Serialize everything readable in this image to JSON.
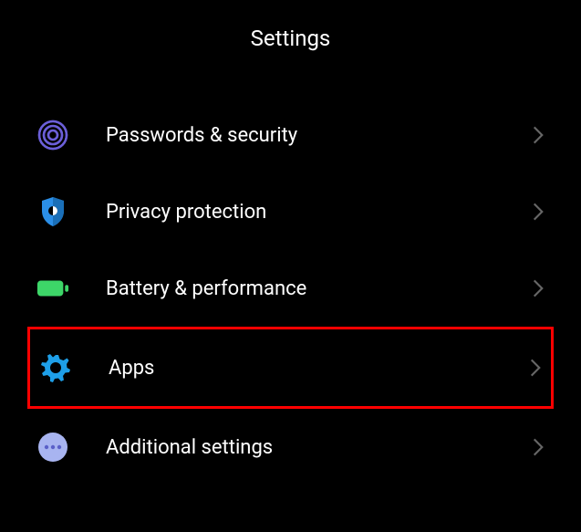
{
  "header": {
    "title": "Settings"
  },
  "items": [
    {
      "label": "Passwords & security",
      "icon": "fingerprint-icon",
      "iconColor": "#6B5FD8",
      "highlighted": false
    },
    {
      "label": "Privacy protection",
      "icon": "shield-icon",
      "iconColor": "#2B8FE8",
      "highlighted": false
    },
    {
      "label": "Battery & performance",
      "icon": "battery-icon",
      "iconColor": "#3DD668",
      "highlighted": false
    },
    {
      "label": "Apps",
      "icon": "gear-icon",
      "iconColor": "#1E9FE8",
      "highlighted": true
    },
    {
      "label": "Additional settings",
      "icon": "dots-icon",
      "iconColor": "#A8B4F0",
      "highlighted": false
    }
  ]
}
